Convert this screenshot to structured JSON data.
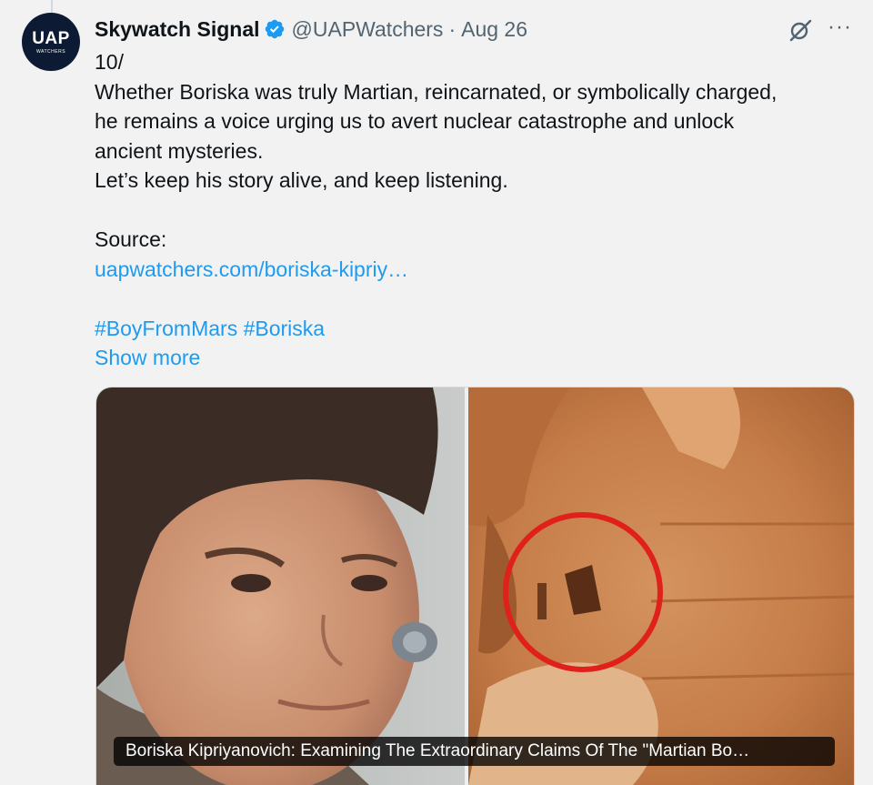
{
  "tweet": {
    "author_name": "Skywatch Signal",
    "handle": "@UAPWatchers",
    "separator": "·",
    "date": "Aug 26",
    "more_label": "···",
    "avatar": {
      "line1": "UAP",
      "line2": "WATCHERS"
    },
    "lines": {
      "l1": "10/",
      "l2": "Whether Boriska was truly Martian, reincarnated, or symbolically charged,",
      "l3": "he remains a voice urging us to avert nuclear catastrophe and unlock",
      "l4": "ancient mysteries.",
      "l5": "Let’s keep his story alive, and keep listening.",
      "l6": "Source:"
    },
    "source_link": "uapwatchers.com/boriska-kipriy…",
    "hashtags": "#BoyFromMars #Boriska",
    "show_more": "Show more",
    "media_caption": "Boriska Kipriyanovich: Examining The Extraordinary Claims Of The \"Martian Bo…"
  },
  "colors": {
    "background": "#f2f2f2",
    "link": "#1d9bf0",
    "secondary_text": "#536471",
    "verified_badge": "#1d9bf0",
    "circle_annotation": "#e0211b"
  },
  "icons": {
    "verified": "verified-badge-icon",
    "grok": "grok-icon",
    "more": "more-options-icon"
  }
}
